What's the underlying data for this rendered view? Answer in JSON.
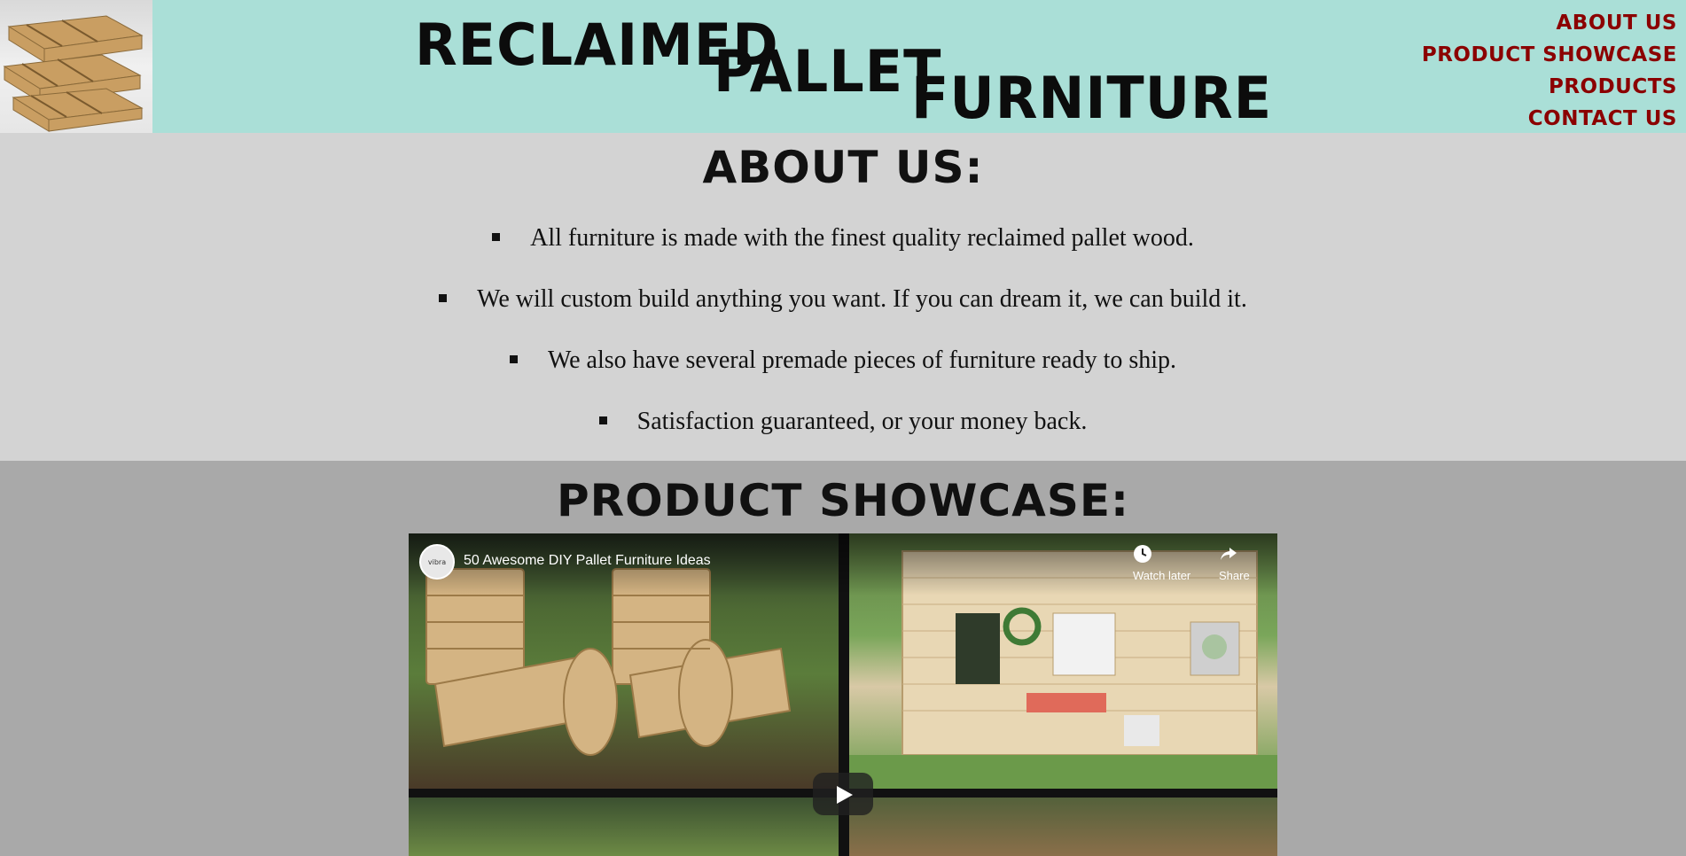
{
  "header": {
    "title_words": [
      "Reclaimed",
      "Pallet",
      "Furniture"
    ],
    "nav": [
      "About Us",
      "Product Showcase",
      "Products",
      "Contact Us"
    ],
    "colors": {
      "background": "#aadfd7",
      "nav": "#8b0000"
    }
  },
  "about": {
    "title": "About Us:",
    "items": [
      "All furniture is made with the finest quality reclaimed pallet wood.",
      "We will custom build anything you want. If you can dream it, we can build it.",
      "We also have several premade pieces of furniture ready to ship.",
      "Satisfaction guaranteed, or your money back."
    ]
  },
  "showcase": {
    "title": "Product Showcase:",
    "video": {
      "title": "50 Awesome DIY Pallet Furniture Ideas",
      "channel_icon": "vibrajozz-channel-avatar",
      "watch_later": "Watch later",
      "share": "Share",
      "play_icon": "play-icon"
    }
  }
}
